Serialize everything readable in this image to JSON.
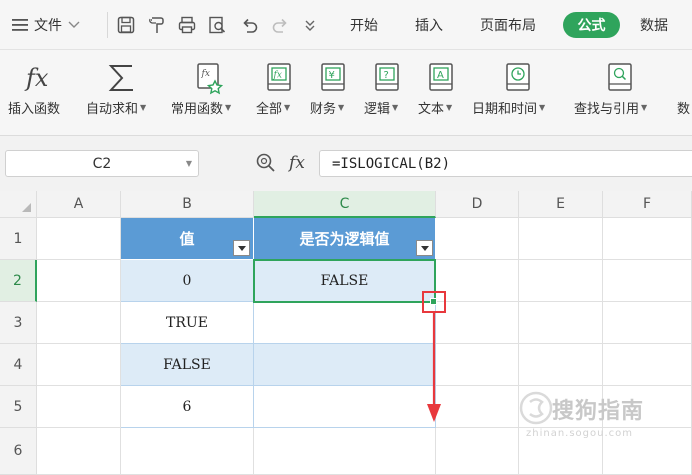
{
  "menu": {
    "file_label": "文件",
    "tabs": [
      {
        "label": "开始"
      },
      {
        "label": "插入"
      },
      {
        "label": "页面布局"
      },
      {
        "label": "公式",
        "active": true
      },
      {
        "label": "数据"
      }
    ]
  },
  "ribbon": {
    "items": [
      {
        "label": "插入函数",
        "icon": "fx-icon",
        "has_dropdown": false
      },
      {
        "label": "自动求和",
        "icon": "sigma-icon",
        "has_dropdown": true
      },
      {
        "label": "常用函数",
        "icon": "star-function-icon",
        "has_dropdown": true
      },
      {
        "label": "全部",
        "icon": "function-book-icon",
        "has_dropdown": true
      },
      {
        "label": "财务",
        "icon": "yen-book-icon",
        "has_dropdown": true
      },
      {
        "label": "逻辑",
        "icon": "question-book-icon",
        "has_dropdown": true
      },
      {
        "label": "文本",
        "icon": "text-book-icon",
        "has_dropdown": true
      },
      {
        "label": "日期和时间",
        "icon": "clock-book-icon",
        "has_dropdown": true
      },
      {
        "label": "查找与引用",
        "icon": "search-book-icon",
        "has_dropdown": true
      },
      {
        "label": "数",
        "icon": "",
        "has_dropdown": false
      }
    ]
  },
  "formula_bar": {
    "name_box": "C2",
    "fx_label": "fx",
    "formula": "=ISLOGICAL(B2)"
  },
  "sheet": {
    "columns": [
      "A",
      "B",
      "C",
      "D",
      "E",
      "F"
    ],
    "rows": [
      "1",
      "2",
      "3",
      "4",
      "5",
      "6"
    ],
    "active_cell": "C2",
    "header_b": "值",
    "header_c": "是否为逻辑值",
    "b_values": [
      "0",
      "TRUE",
      "FALSE",
      "6"
    ],
    "c_values": [
      "FALSE",
      "",
      "",
      ""
    ]
  },
  "watermark": {
    "text": "搜狗指南",
    "sub": "zhinan.sogou.com"
  },
  "colors": {
    "accent": "#2fa45c",
    "table_header": "#5b9bd5",
    "table_band": "#ddebf7",
    "annotation": "#e8383d"
  }
}
